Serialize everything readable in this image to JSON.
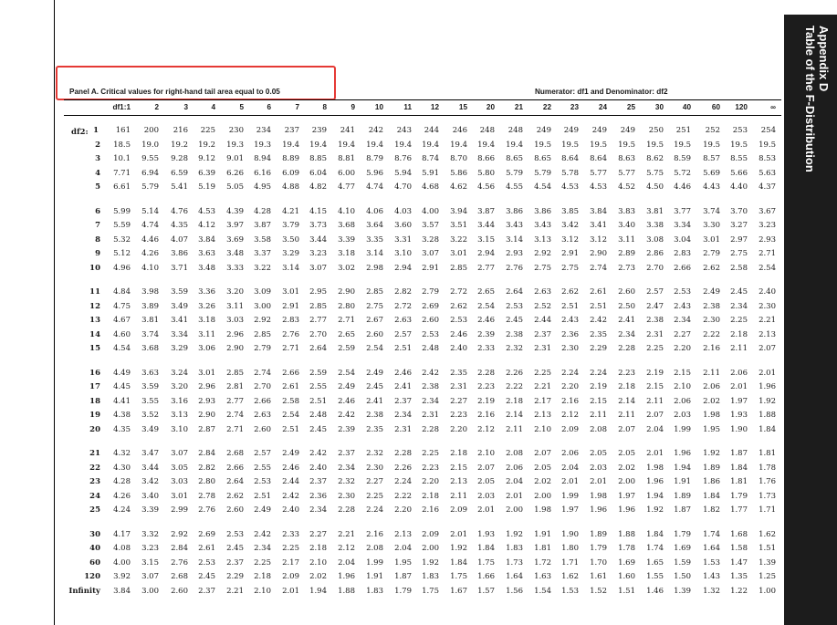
{
  "sidebar": {
    "appendix_label": "Appendix D",
    "appendix_title": "Table of the F-Distribution"
  },
  "panel": {
    "title": "Panel A. Critical values for right-hand tail area equal to 0.05",
    "numerator_label": "Numerator: df1 and Denominator: df2"
  },
  "table": {
    "df1_label": "df1:1",
    "df2_label": "df2:",
    "columns": [
      "2",
      "3",
      "4",
      "5",
      "6",
      "7",
      "8",
      "9",
      "10",
      "11",
      "12",
      "15",
      "20",
      "21",
      "22",
      "23",
      "24",
      "25",
      "30",
      "40",
      "60",
      "120",
      "∞"
    ],
    "rows": [
      {
        "label": "1",
        "values": [
          "161",
          "200",
          "216",
          "225",
          "230",
          "234",
          "237",
          "239",
          "241",
          "242",
          "243",
          "244",
          "246",
          "248",
          "248",
          "249",
          "249",
          "249",
          "249",
          "250",
          "251",
          "252",
          "253",
          "254"
        ]
      },
      {
        "label": "2",
        "values": [
          "18.5",
          "19.0",
          "19.2",
          "19.2",
          "19.3",
          "19.3",
          "19.4",
          "19.4",
          "19.4",
          "19.4",
          "19.4",
          "19.4",
          "19.4",
          "19.4",
          "19.4",
          "19.5",
          "19.5",
          "19.5",
          "19.5",
          "19.5",
          "19.5",
          "19.5",
          "19.5",
          "19.5"
        ]
      },
      {
        "label": "3",
        "values": [
          "10.1",
          "9.55",
          "9.28",
          "9.12",
          "9.01",
          "8.94",
          "8.89",
          "8.85",
          "8.81",
          "8.79",
          "8.76",
          "8.74",
          "8.70",
          "8.66",
          "8.65",
          "8.65",
          "8.64",
          "8.64",
          "8.63",
          "8.62",
          "8.59",
          "8.57",
          "8.55",
          "8.53"
        ]
      },
      {
        "label": "4",
        "values": [
          "7.71",
          "6.94",
          "6.59",
          "6.39",
          "6.26",
          "6.16",
          "6.09",
          "6.04",
          "6.00",
          "5.96",
          "5.94",
          "5.91",
          "5.86",
          "5.80",
          "5.79",
          "5.79",
          "5.78",
          "5.77",
          "5.77",
          "5.75",
          "5.72",
          "5.69",
          "5.66",
          "5.63"
        ]
      },
      {
        "label": "5",
        "values": [
          "6.61",
          "5.79",
          "5.41",
          "5.19",
          "5.05",
          "4.95",
          "4.88",
          "4.82",
          "4.77",
          "4.74",
          "4.70",
          "4.68",
          "4.62",
          "4.56",
          "4.55",
          "4.54",
          "4.53",
          "4.53",
          "4.52",
          "4.50",
          "4.46",
          "4.43",
          "4.40",
          "4.37"
        ]
      },
      {
        "label": "6",
        "values": [
          "5.99",
          "5.14",
          "4.76",
          "4.53",
          "4.39",
          "4.28",
          "4.21",
          "4.15",
          "4.10",
          "4.06",
          "4.03",
          "4.00",
          "3.94",
          "3.87",
          "3.86",
          "3.86",
          "3.85",
          "3.84",
          "3.83",
          "3.81",
          "3.77",
          "3.74",
          "3.70",
          "3.67"
        ]
      },
      {
        "label": "7",
        "values": [
          "5.59",
          "4.74",
          "4.35",
          "4.12",
          "3.97",
          "3.87",
          "3.79",
          "3.73",
          "3.68",
          "3.64",
          "3.60",
          "3.57",
          "3.51",
          "3.44",
          "3.43",
          "3.43",
          "3.42",
          "3.41",
          "3.40",
          "3.38",
          "3.34",
          "3.30",
          "3.27",
          "3.23"
        ]
      },
      {
        "label": "8",
        "values": [
          "5.32",
          "4.46",
          "4.07",
          "3.84",
          "3.69",
          "3.58",
          "3.50",
          "3.44",
          "3.39",
          "3.35",
          "3.31",
          "3.28",
          "3.22",
          "3.15",
          "3.14",
          "3.13",
          "3.12",
          "3.12",
          "3.11",
          "3.08",
          "3.04",
          "3.01",
          "2.97",
          "2.93"
        ]
      },
      {
        "label": "9",
        "values": [
          "5.12",
          "4.26",
          "3.86",
          "3.63",
          "3.48",
          "3.37",
          "3.29",
          "3.23",
          "3.18",
          "3.14",
          "3.10",
          "3.07",
          "3.01",
          "2.94",
          "2.93",
          "2.92",
          "2.91",
          "2.90",
          "2.89",
          "2.86",
          "2.83",
          "2.79",
          "2.75",
          "2.71"
        ]
      },
      {
        "label": "10",
        "values": [
          "4.96",
          "4.10",
          "3.71",
          "3.48",
          "3.33",
          "3.22",
          "3.14",
          "3.07",
          "3.02",
          "2.98",
          "2.94",
          "2.91",
          "2.85",
          "2.77",
          "2.76",
          "2.75",
          "2.75",
          "2.74",
          "2.73",
          "2.70",
          "2.66",
          "2.62",
          "2.58",
          "2.54"
        ]
      },
      {
        "label": "11",
        "values": [
          "4.84",
          "3.98",
          "3.59",
          "3.36",
          "3.20",
          "3.09",
          "3.01",
          "2.95",
          "2.90",
          "2.85",
          "2.82",
          "2.79",
          "2.72",
          "2.65",
          "2.64",
          "2.63",
          "2.62",
          "2.61",
          "2.60",
          "2.57",
          "2.53",
          "2.49",
          "2.45",
          "2.40"
        ]
      },
      {
        "label": "12",
        "values": [
          "4.75",
          "3.89",
          "3.49",
          "3.26",
          "3.11",
          "3.00",
          "2.91",
          "2.85",
          "2.80",
          "2.75",
          "2.72",
          "2.69",
          "2.62",
          "2.54",
          "2.53",
          "2.52",
          "2.51",
          "2.51",
          "2.50",
          "2.47",
          "2.43",
          "2.38",
          "2.34",
          "2.30"
        ]
      },
      {
        "label": "13",
        "values": [
          "4.67",
          "3.81",
          "3.41",
          "3.18",
          "3.03",
          "2.92",
          "2.83",
          "2.77",
          "2.71",
          "2.67",
          "2.63",
          "2.60",
          "2.53",
          "2.46",
          "2.45",
          "2.44",
          "2.43",
          "2.42",
          "2.41",
          "2.38",
          "2.34",
          "2.30",
          "2.25",
          "2.21"
        ]
      },
      {
        "label": "14",
        "values": [
          "4.60",
          "3.74",
          "3.34",
          "3.11",
          "2.96",
          "2.85",
          "2.76",
          "2.70",
          "2.65",
          "2.60",
          "2.57",
          "2.53",
          "2.46",
          "2.39",
          "2.38",
          "2.37",
          "2.36",
          "2.35",
          "2.34",
          "2.31",
          "2.27",
          "2.22",
          "2.18",
          "2.13"
        ]
      },
      {
        "label": "15",
        "values": [
          "4.54",
          "3.68",
          "3.29",
          "3.06",
          "2.90",
          "2.79",
          "2.71",
          "2.64",
          "2.59",
          "2.54",
          "2.51",
          "2.48",
          "2.40",
          "2.33",
          "2.32",
          "2.31",
          "2.30",
          "2.29",
          "2.28",
          "2.25",
          "2.20",
          "2.16",
          "2.11",
          "2.07"
        ]
      },
      {
        "label": "16",
        "values": [
          "4.49",
          "3.63",
          "3.24",
          "3.01",
          "2.85",
          "2.74",
          "2.66",
          "2.59",
          "2.54",
          "2.49",
          "2.46",
          "2.42",
          "2.35",
          "2.28",
          "2.26",
          "2.25",
          "2.24",
          "2.24",
          "2.23",
          "2.19",
          "2.15",
          "2.11",
          "2.06",
          "2.01"
        ]
      },
      {
        "label": "17",
        "values": [
          "4.45",
          "3.59",
          "3.20",
          "2.96",
          "2.81",
          "2.70",
          "2.61",
          "2.55",
          "2.49",
          "2.45",
          "2.41",
          "2.38",
          "2.31",
          "2.23",
          "2.22",
          "2.21",
          "2.20",
          "2.19",
          "2.18",
          "2.15",
          "2.10",
          "2.06",
          "2.01",
          "1.96"
        ]
      },
      {
        "label": "18",
        "values": [
          "4.41",
          "3.55",
          "3.16",
          "2.93",
          "2.77",
          "2.66",
          "2.58",
          "2.51",
          "2.46",
          "2.41",
          "2.37",
          "2.34",
          "2.27",
          "2.19",
          "2.18",
          "2.17",
          "2.16",
          "2.15",
          "2.14",
          "2.11",
          "2.06",
          "2.02",
          "1.97",
          "1.92"
        ]
      },
      {
        "label": "19",
        "values": [
          "4.38",
          "3.52",
          "3.13",
          "2.90",
          "2.74",
          "2.63",
          "2.54",
          "2.48",
          "2.42",
          "2.38",
          "2.34",
          "2.31",
          "2.23",
          "2.16",
          "2.14",
          "2.13",
          "2.12",
          "2.11",
          "2.11",
          "2.07",
          "2.03",
          "1.98",
          "1.93",
          "1.88"
        ]
      },
      {
        "label": "20",
        "values": [
          "4.35",
          "3.49",
          "3.10",
          "2.87",
          "2.71",
          "2.60",
          "2.51",
          "2.45",
          "2.39",
          "2.35",
          "2.31",
          "2.28",
          "2.20",
          "2.12",
          "2.11",
          "2.10",
          "2.09",
          "2.08",
          "2.07",
          "2.04",
          "1.99",
          "1.95",
          "1.90",
          "1.84"
        ]
      },
      {
        "label": "21",
        "values": [
          "4.32",
          "3.47",
          "3.07",
          "2.84",
          "2.68",
          "2.57",
          "2.49",
          "2.42",
          "2.37",
          "2.32",
          "2.28",
          "2.25",
          "2.18",
          "2.10",
          "2.08",
          "2.07",
          "2.06",
          "2.05",
          "2.05",
          "2.01",
          "1.96",
          "1.92",
          "1.87",
          "1.81"
        ]
      },
      {
        "label": "22",
        "values": [
          "4.30",
          "3.44",
          "3.05",
          "2.82",
          "2.66",
          "2.55",
          "2.46",
          "2.40",
          "2.34",
          "2.30",
          "2.26",
          "2.23",
          "2.15",
          "2.07",
          "2.06",
          "2.05",
          "2.04",
          "2.03",
          "2.02",
          "1.98",
          "1.94",
          "1.89",
          "1.84",
          "1.78"
        ]
      },
      {
        "label": "23",
        "values": [
          "4.28",
          "3.42",
          "3.03",
          "2.80",
          "2.64",
          "2.53",
          "2.44",
          "2.37",
          "2.32",
          "2.27",
          "2.24",
          "2.20",
          "2.13",
          "2.05",
          "2.04",
          "2.02",
          "2.01",
          "2.01",
          "2.00",
          "1.96",
          "1.91",
          "1.86",
          "1.81",
          "1.76"
        ]
      },
      {
        "label": "24",
        "values": [
          "4.26",
          "3.40",
          "3.01",
          "2.78",
          "2.62",
          "2.51",
          "2.42",
          "2.36",
          "2.30",
          "2.25",
          "2.22",
          "2.18",
          "2.11",
          "2.03",
          "2.01",
          "2.00",
          "1.99",
          "1.98",
          "1.97",
          "1.94",
          "1.89",
          "1.84",
          "1.79",
          "1.73"
        ]
      },
      {
        "label": "25",
        "values": [
          "4.24",
          "3.39",
          "2.99",
          "2.76",
          "2.60",
          "2.49",
          "2.40",
          "2.34",
          "2.28",
          "2.24",
          "2.20",
          "2.16",
          "2.09",
          "2.01",
          "2.00",
          "1.98",
          "1.97",
          "1.96",
          "1.96",
          "1.92",
          "1.87",
          "1.82",
          "1.77",
          "1.71"
        ]
      },
      {
        "label": "30",
        "values": [
          "4.17",
          "3.32",
          "2.92",
          "2.69",
          "2.53",
          "2.42",
          "2.33",
          "2.27",
          "2.21",
          "2.16",
          "2.13",
          "2.09",
          "2.01",
          "1.93",
          "1.92",
          "1.91",
          "1.90",
          "1.89",
          "1.88",
          "1.84",
          "1.79",
          "1.74",
          "1.68",
          "1.62"
        ]
      },
      {
        "label": "40",
        "values": [
          "4.08",
          "3.23",
          "2.84",
          "2.61",
          "2.45",
          "2.34",
          "2.25",
          "2.18",
          "2.12",
          "2.08",
          "2.04",
          "2.00",
          "1.92",
          "1.84",
          "1.83",
          "1.81",
          "1.80",
          "1.79",
          "1.78",
          "1.74",
          "1.69",
          "1.64",
          "1.58",
          "1.51"
        ]
      },
      {
        "label": "60",
        "values": [
          "4.00",
          "3.15",
          "2.76",
          "2.53",
          "2.37",
          "2.25",
          "2.17",
          "2.10",
          "2.04",
          "1.99",
          "1.95",
          "1.92",
          "1.84",
          "1.75",
          "1.73",
          "1.72",
          "1.71",
          "1.70",
          "1.69",
          "1.65",
          "1.59",
          "1.53",
          "1.47",
          "1.39"
        ]
      },
      {
        "label": "120",
        "values": [
          "3.92",
          "3.07",
          "2.68",
          "2.45",
          "2.29",
          "2.18",
          "2.09",
          "2.02",
          "1.96",
          "1.91",
          "1.87",
          "1.83",
          "1.75",
          "1.66",
          "1.64",
          "1.63",
          "1.62",
          "1.61",
          "1.60",
          "1.55",
          "1.50",
          "1.43",
          "1.35",
          "1.25"
        ]
      },
      {
        "label": "Infinity",
        "values": [
          "3.84",
          "3.00",
          "2.60",
          "2.37",
          "2.21",
          "2.10",
          "2.01",
          "1.94",
          "1.88",
          "1.83",
          "1.79",
          "1.75",
          "1.67",
          "1.57",
          "1.56",
          "1.54",
          "1.53",
          "1.52",
          "1.51",
          "1.46",
          "1.39",
          "1.32",
          "1.22",
          "1.00"
        ]
      }
    ]
  }
}
